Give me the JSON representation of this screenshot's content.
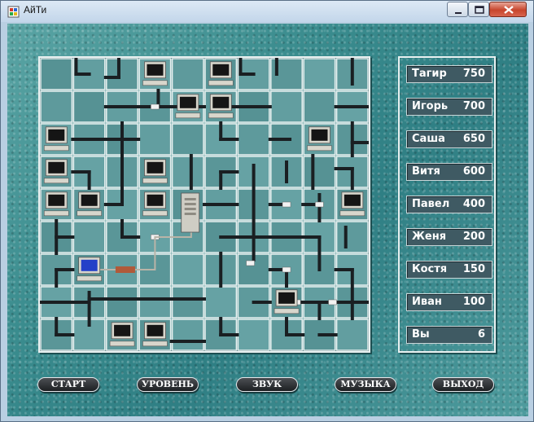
{
  "window": {
    "title": "АйТи"
  },
  "scores": [
    {
      "name": "Тагир",
      "value": "750"
    },
    {
      "name": "Игорь",
      "value": "700"
    },
    {
      "name": "Саша",
      "value": "650"
    },
    {
      "name": "Витя",
      "value": "600"
    },
    {
      "name": "Павел",
      "value": "400"
    },
    {
      "name": "Женя",
      "value": "200"
    },
    {
      "name": "Костя",
      "value": "150"
    },
    {
      "name": "Иван",
      "value": "100"
    },
    {
      "name": "Вы",
      "value": "6"
    }
  ],
  "buttons": {
    "start": "СТАРТ",
    "level": "УРОВЕНЬ",
    "sound": "ЗВУК",
    "music": "МУЗЫКА",
    "exit": "ВЫХОД"
  },
  "board": {
    "columns": 9,
    "rows": 9,
    "computers_off": [
      [
        3,
        0
      ],
      [
        5,
        0
      ],
      [
        4,
        1
      ],
      [
        5,
        1
      ],
      [
        0,
        2
      ],
      [
        8,
        2
      ],
      [
        0,
        3
      ],
      [
        3,
        3
      ],
      [
        0,
        4
      ],
      [
        1,
        4
      ],
      [
        3,
        4
      ],
      [
        9,
        4
      ],
      [
        7,
        7
      ],
      [
        2,
        8
      ],
      [
        3,
        8
      ]
    ],
    "computers_on": [
      [
        1,
        6
      ]
    ],
    "server": [
      4,
      4
    ]
  },
  "colors": {
    "board": "#5e9a9c",
    "cell_border": "#e9f1f1",
    "score_row": "#3f5a63",
    "button": "#1d1f22",
    "pipe": "#1a1f22"
  }
}
